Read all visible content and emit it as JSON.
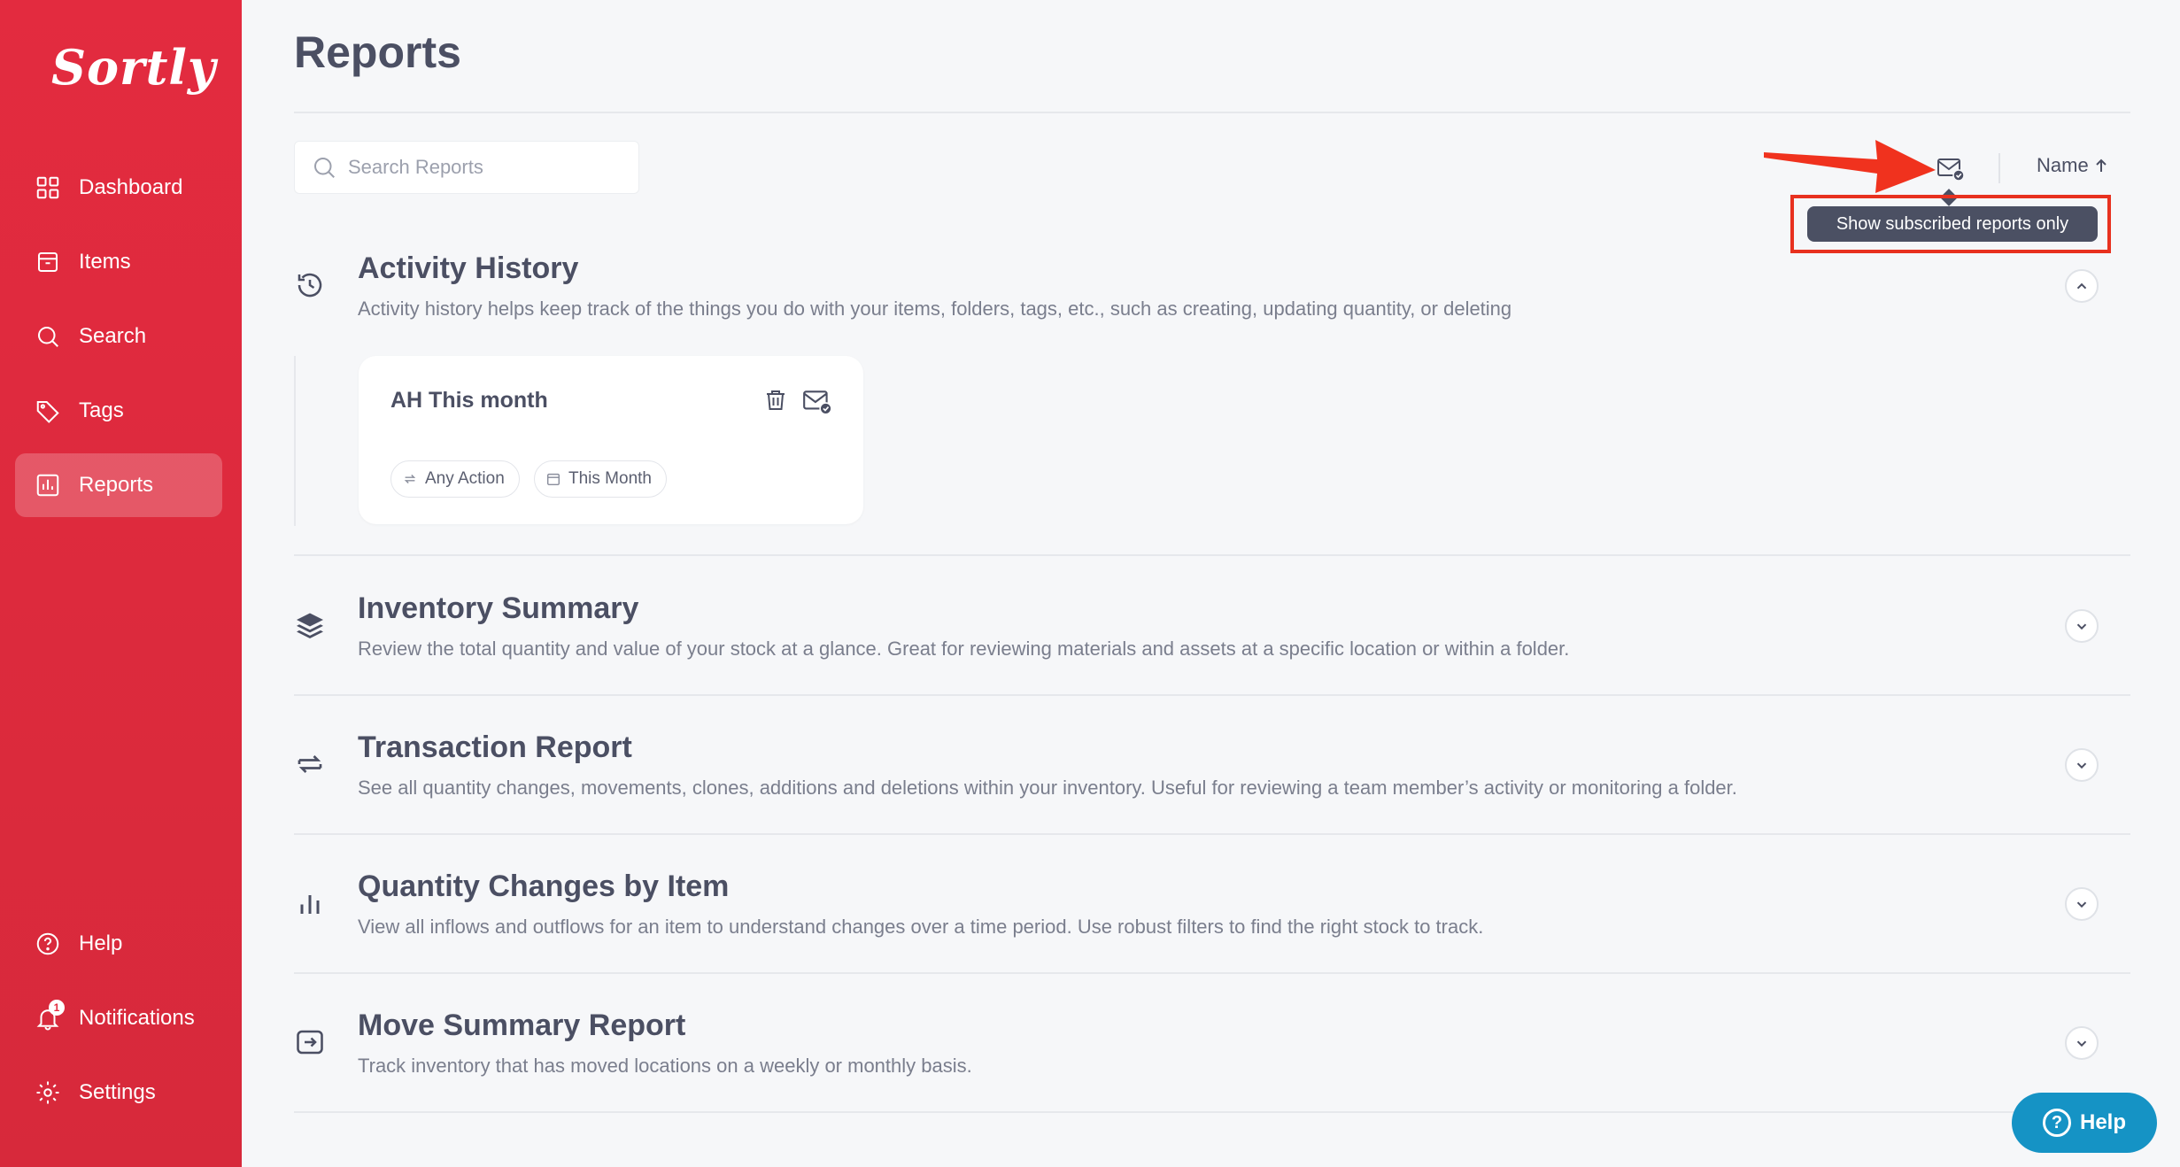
{
  "app": {
    "logo_text": "Sortly",
    "brand_color": "#e32b3f"
  },
  "sidebar": {
    "items": [
      {
        "label": "Dashboard",
        "icon": "dashboard-icon"
      },
      {
        "label": "Items",
        "icon": "items-icon"
      },
      {
        "label": "Search",
        "icon": "search-icon"
      },
      {
        "label": "Tags",
        "icon": "tag-icon"
      },
      {
        "label": "Reports",
        "icon": "reports-icon",
        "active": true
      }
    ],
    "bottom_items": [
      {
        "label": "Help",
        "icon": "help-icon"
      },
      {
        "label": "Notifications",
        "icon": "bell-icon",
        "badge": "1"
      },
      {
        "label": "Settings",
        "icon": "gear-icon"
      }
    ]
  },
  "header": {
    "title": "Reports"
  },
  "toolbar": {
    "search_placeholder": "Search Reports",
    "tooltip": "Show subscribed reports only",
    "sort_label": "Name"
  },
  "sections": [
    {
      "title": "Activity History",
      "description": "Activity history helps keep track of the things you do with your items, folders, tags, etc., such as creating, updating quantity, or deleting",
      "expanded": true,
      "reports": [
        {
          "title": "AH This month",
          "chips": [
            "Any Action",
            "This Month"
          ]
        }
      ]
    },
    {
      "title": "Inventory Summary",
      "description": "Review the total quantity and value of your stock at a glance. Great for reviewing materials and assets at a specific location or within a folder."
    },
    {
      "title": "Transaction Report",
      "description": "See all quantity changes, movements, clones, additions and deletions within your inventory. Useful for reviewing a team member’s activity or monitoring a folder."
    },
    {
      "title": "Quantity Changes by Item",
      "description": "View all inflows and outflows for an item to understand changes over a time period. Use robust filters to find the right stock to track."
    },
    {
      "title": "Move Summary Report",
      "description": "Track inventory that has moved locations on a weekly or monthly basis."
    }
  ],
  "help_widget": {
    "label": "Help"
  }
}
